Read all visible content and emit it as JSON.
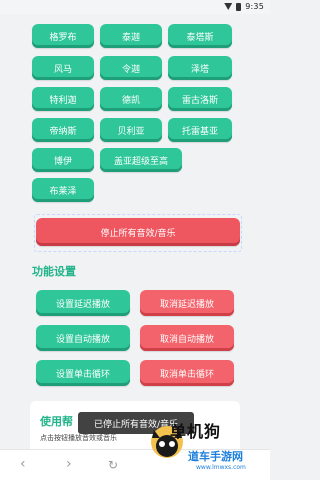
{
  "status_bar": {
    "time": "9:35"
  },
  "sound_buttons": [
    "格罗布",
    "泰迦",
    "泰塔斯",
    "风马",
    "令迦",
    "泽塔",
    "特利迦",
    "德凯",
    "雷古洛斯",
    "帝纳斯",
    "贝利亚",
    "托雷基亚",
    "博伊",
    "盖亚超级至高",
    "布莱泽"
  ],
  "stop_all": "停止所有音效/音乐",
  "settings": {
    "title": "功能设置",
    "set_delay": "设置延迟播放",
    "cancel_delay": "取消延迟播放",
    "set_auto": "设置自动播放",
    "cancel_auto": "取消自动播放",
    "set_loop": "设置单击循环",
    "cancel_loop": "取消单击循环"
  },
  "help": {
    "title": "使用帮",
    "text": "点击按钮播放音效或音乐"
  },
  "toast": "已停止所有音效/音乐",
  "watermark": {
    "title": "单机狗",
    "sub": "道车手游网",
    "url": "www.lmwxs.com"
  },
  "colors": {
    "green": "#2fc79a",
    "red": "#f3636b",
    "accent_text": "#23b48a"
  }
}
